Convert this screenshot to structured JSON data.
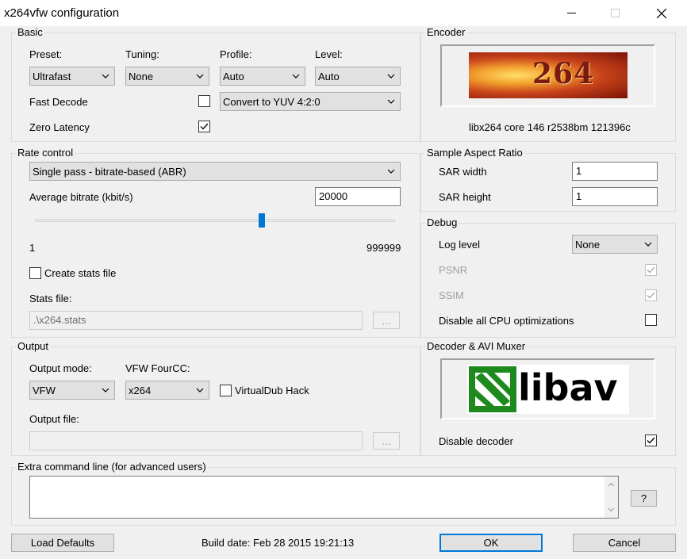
{
  "window": {
    "title": "x264vfw configuration"
  },
  "basic": {
    "label": "Basic",
    "preset_label": "Preset:",
    "preset_value": "Ultrafast",
    "tuning_label": "Tuning:",
    "tuning_value": "None",
    "profile_label": "Profile:",
    "profile_value": "Auto",
    "level_label": "Level:",
    "level_value": "Auto",
    "fast_decode_label": "Fast Decode",
    "colorspace_value": "Convert to YUV 4:2:0",
    "zero_latency_label": "Zero Latency"
  },
  "encoder": {
    "label": "Encoder",
    "logo_text": "264",
    "version": "libx264 core 146 r2538bm 121396c"
  },
  "rate_control": {
    "label": "Rate control",
    "mode_value": "Single pass - bitrate-based (ABR)",
    "bitrate_label": "Average bitrate (kbit/s)",
    "bitrate_value": "20000",
    "slider_min": "1",
    "slider_max": "999999",
    "slider_fraction": 0.63,
    "create_stats_label": "Create stats file",
    "stats_file_label": "Stats file:",
    "stats_file_value": ".\\x264.stats",
    "browse_label": "..."
  },
  "sar": {
    "label": "Sample Aspect Ratio",
    "width_label": "SAR width",
    "width_value": "1",
    "height_label": "SAR height",
    "height_value": "1"
  },
  "debug": {
    "label": "Debug",
    "log_level_label": "Log level",
    "log_level_value": "None",
    "psnr_label": "PSNR",
    "ssim_label": "SSIM",
    "disable_cpu_label": "Disable all CPU optimizations"
  },
  "output": {
    "label": "Output",
    "mode_label": "Output mode:",
    "mode_value": "VFW",
    "fourcc_label": "VFW FourCC:",
    "fourcc_value": "x264",
    "vdub_hack_label": "VirtualDub Hack",
    "file_label": "Output file:",
    "file_value": "",
    "browse_label": "..."
  },
  "decoder": {
    "label": "Decoder & AVI Muxer",
    "logo_text": "libav",
    "disable_decoder_label": "Disable decoder"
  },
  "extra": {
    "label": "Extra command line (for advanced users)",
    "value": "",
    "help_label": "?"
  },
  "footer": {
    "load_defaults_label": "Load Defaults",
    "build_date": "Build date: Feb 28 2015 19:21:13",
    "ok_label": "OK",
    "cancel_label": "Cancel"
  },
  "checks": {
    "fast_decode": false,
    "zero_latency": true,
    "create_stats": false,
    "psnr": true,
    "ssim": true,
    "disable_cpu": false,
    "vdub_hack": false,
    "disable_decoder": true
  },
  "colors": {
    "accent": "#0078d7",
    "window_bg": "#f0f0f0",
    "logo_green": "#1e8a1e"
  },
  "icons": [
    "minimize-icon",
    "maximize-icon",
    "close-icon",
    "chevron-down-icon",
    "checkmark-icon",
    "scroll-up-icon",
    "scroll-down-icon"
  ]
}
